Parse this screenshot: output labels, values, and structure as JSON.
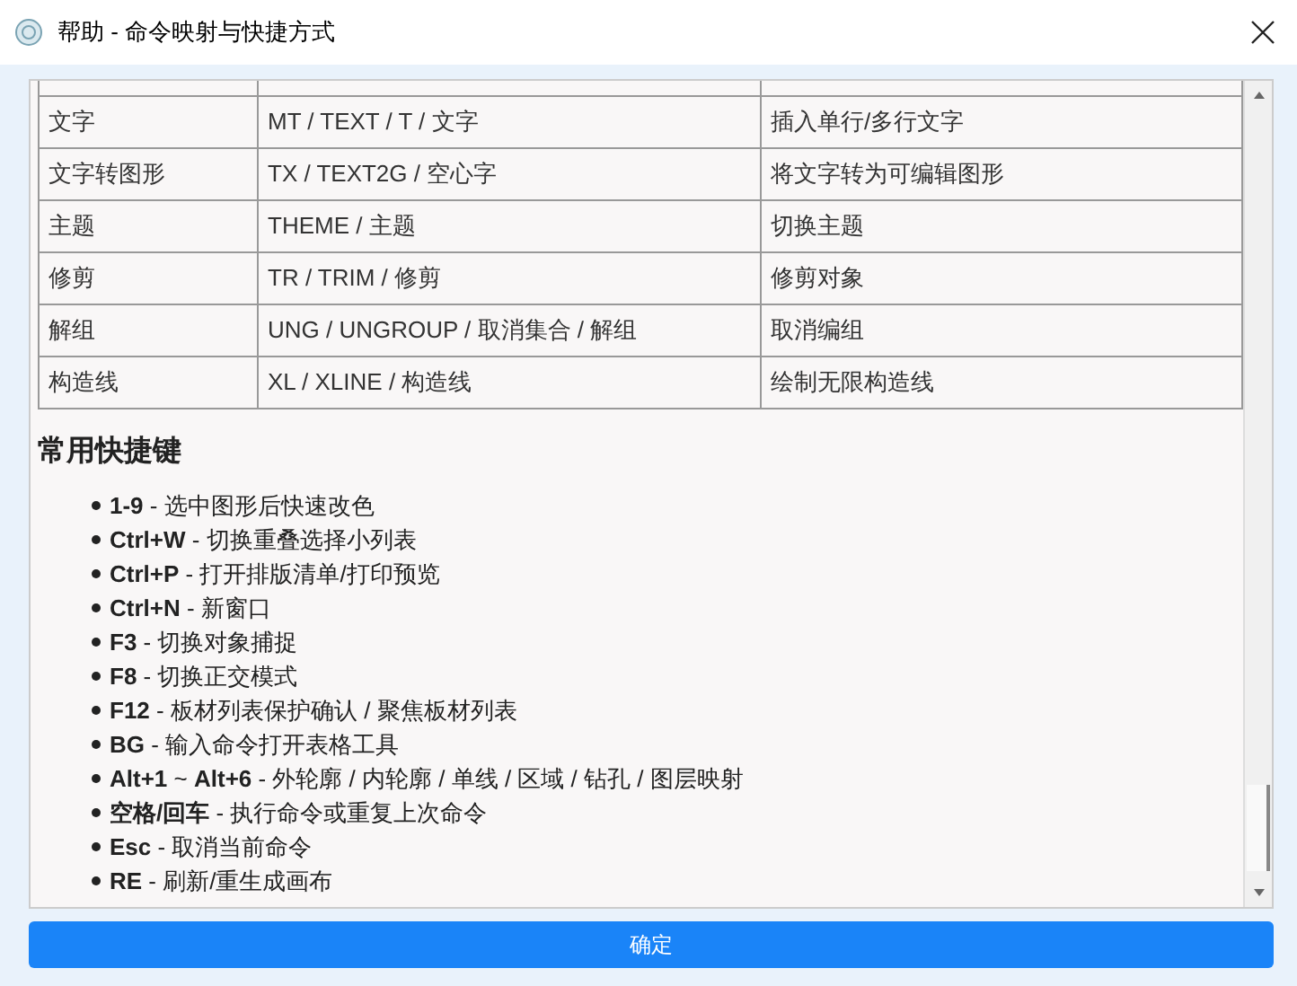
{
  "window": {
    "title": "帮助 - 命令映射与快捷方式"
  },
  "table": {
    "rows": [
      [
        "文字",
        "MT / TEXT / T / 文字",
        "插入单行/多行文字"
      ],
      [
        "文字转图形",
        "TX / TEXT2G / 空心字",
        "将文字转为可编辑图形"
      ],
      [
        "主题",
        "THEME / 主题",
        "切换主题"
      ],
      [
        "修剪",
        "TR / TRIM / 修剪",
        "修剪对象"
      ],
      [
        "解组",
        "UNG / UNGROUP / 取消集合 / 解组",
        "取消编组"
      ],
      [
        "构造线",
        "XL / XLINE / 构造线",
        "绘制无限构造线"
      ]
    ]
  },
  "shortcuts": {
    "heading": "常用快捷键",
    "items": [
      "**1-9** - 选中图形后快速改色",
      "**Ctrl+W** - 切换重叠选择小列表",
      "**Ctrl+P** - 打开排版清单/打印预览",
      "**Ctrl+N** - 新窗口",
      "**F3** - 切换对象捕捉",
      "**F8** - 切换正交模式",
      "**F12** - 板材列表保护确认 / 聚焦板材列表",
      "**BG** - 输入命令打开表格工具",
      "**Alt+1** ~ **Alt+6** - 外轮廓 / 内轮廓 / 单线 / 区域 / 钻孔 / 图层映射",
      "**空格/回车** - 执行命令或重复上次命令",
      "**Esc** - 取消当前命令",
      "**RE** - 刷新/重生成画布"
    ]
  },
  "ok_button": "确定"
}
